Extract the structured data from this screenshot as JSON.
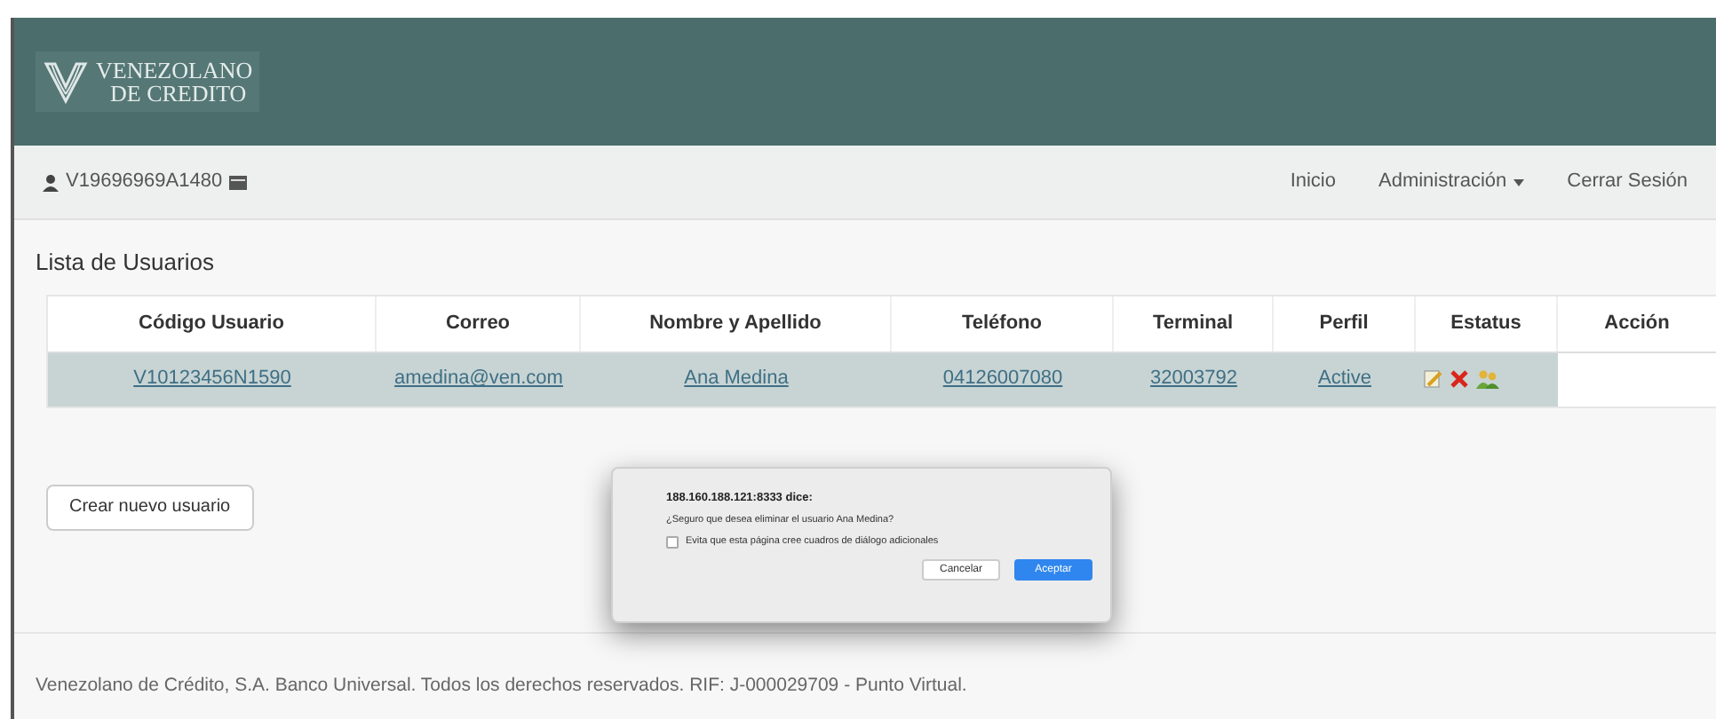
{
  "header": {
    "logo_line_1": "VENEZOLANO",
    "logo_line_2": "DE CREDITO"
  },
  "navbar": {
    "user": "V19696969A1480",
    "links": [
      {
        "label": "Inicio",
        "dropdown": false
      },
      {
        "label": "Administración",
        "dropdown": true
      },
      {
        "label": "Cerrar Sesión",
        "dropdown": false
      }
    ]
  },
  "page_title": "Lista de Usuarios",
  "table": {
    "columns": [
      "Código Usuario",
      "Correo",
      "Nombre y Apellido",
      "Teléfono",
      "Terminal",
      "Perfil",
      "Estatus",
      "Acción"
    ],
    "rows": [
      {
        "cells": [
          "V10123456N1590",
          "amedina@ven.com",
          "Ana Medina",
          "04126007080",
          "32003792",
          "Active"
        ]
      }
    ]
  },
  "create_button": "Crear nuevo usuario",
  "dialog": {
    "origin": "188.160.188.121:8333 dice:",
    "message": "¿Seguro que desea eliminar el usuario Ana Medina?",
    "checkbox": {
      "label": "Evita que esta página cree cuadros de diálogo adicionales",
      "checked": false
    },
    "buttons": [
      {
        "label": "Cancelar",
        "primary": false
      },
      {
        "label": "Aceptar",
        "primary": true
      }
    ]
  },
  "footer": "Venezolano de Crédito, S.A. Banco Universal. Todos los derechos reservados. RIF: J-000029709 - Punto Virtual."
}
